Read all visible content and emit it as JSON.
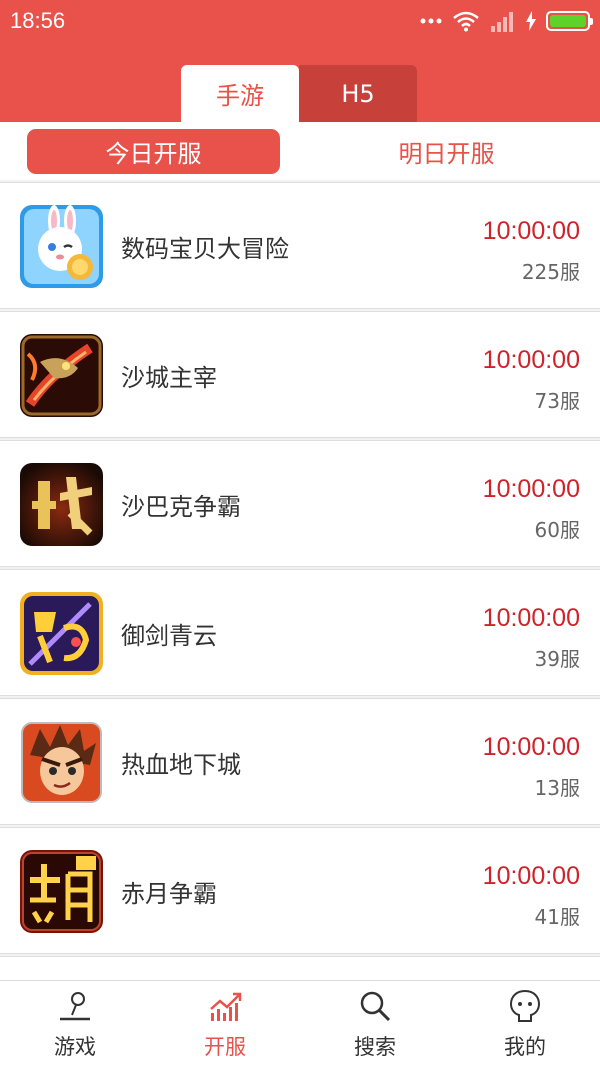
{
  "status_bar": {
    "time": "18:56"
  },
  "top_tabs": [
    {
      "label": "手游",
      "active": true
    },
    {
      "label": "H5",
      "active": false
    }
  ],
  "sub_tabs": [
    {
      "label": "今日开服",
      "active": true
    },
    {
      "label": "明日开服",
      "active": false
    }
  ],
  "games": [
    {
      "name": "数码宝贝大冒险",
      "time": "10:00:00",
      "server": "225服",
      "icon": "bunny-mascot-icon"
    },
    {
      "name": "沙城主宰",
      "time": "10:00:00",
      "server": "73服",
      "icon": "dragon-sword-icon"
    },
    {
      "name": "沙巴克争霸",
      "time": "10:00:00",
      "server": "60服",
      "icon": "zhan-character-icon"
    },
    {
      "name": "御剑青云",
      "time": "10:00:00",
      "server": "39服",
      "icon": "yujian-logo-icon"
    },
    {
      "name": "热血地下城",
      "time": "10:00:00",
      "server": "13服",
      "icon": "anime-hero-icon"
    },
    {
      "name": "赤月争霸",
      "time": "10:00:00",
      "server": "41服",
      "icon": "chiyue-logo-icon"
    }
  ],
  "bottom_nav": [
    {
      "label": "游戏",
      "icon": "joystick-icon",
      "active": false
    },
    {
      "label": "开服",
      "icon": "chart-up-icon",
      "active": true
    },
    {
      "label": "搜索",
      "icon": "search-icon",
      "active": false
    },
    {
      "label": "我的",
      "icon": "user-face-icon",
      "active": false
    }
  ],
  "colors": {
    "accent": "#e8524a",
    "time_red": "#d0222a",
    "tab_dark": "#c8403a"
  }
}
